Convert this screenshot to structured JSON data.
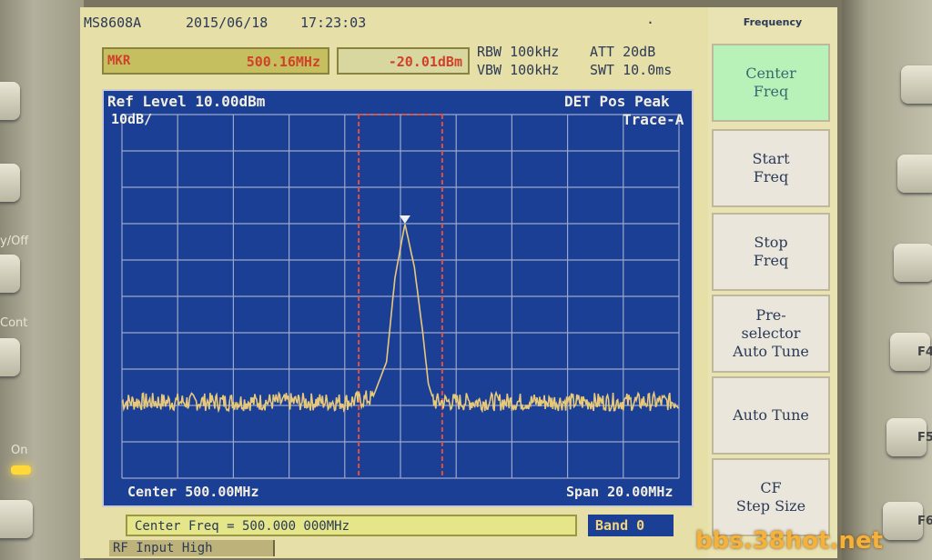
{
  "status": {
    "model": "MS8608A",
    "date": "2015/06/18",
    "time": "17:23:03",
    "indicator": "·"
  },
  "marker": {
    "label": "MKR",
    "frequency": "500.16MHz",
    "amplitude": "-20.01dBm"
  },
  "params": {
    "rbw": "RBW 100kHz",
    "vbw": "VBW 100kHz",
    "att": "ATT 20dB",
    "swt": "SWT 10.0ms"
  },
  "graph": {
    "ref_level": "Ref Level  10.00dBm",
    "scale": "10dB/",
    "detector": "DET  Pos Peak",
    "trace": "Trace-A",
    "center": "Center 500.00MHz",
    "span": "Span 20.00MHz"
  },
  "chart_data": {
    "type": "line",
    "title": "",
    "xlabel": "",
    "ylabel": "",
    "x_center_mhz": 500.0,
    "x_span_mhz": 20.0,
    "xlim": [
      490.0,
      510.0
    ],
    "ref_level_dbm": 10.0,
    "db_per_div": 10,
    "ylim": [
      -90,
      10
    ],
    "grid": true,
    "series": [
      {
        "x": [
          490.0,
          492.0,
          494.0,
          496.0,
          498.0,
          499.0,
          499.5,
          499.8,
          500.16,
          500.5,
          500.8,
          501.0,
          501.2,
          502.0,
          504.0,
          506.0,
          508.0,
          510.0
        ],
        "y": [
          -69.0,
          -69.0,
          -69.0,
          -69.0,
          -69.0,
          -68.0,
          -58.0,
          -35.0,
          -20.01,
          -32.0,
          -50.0,
          -64.0,
          -69.0,
          -69.0,
          -69.0,
          -69.0,
          -69.0,
          -69.0
        ]
      }
    ],
    "noise_floor_dbm": -69.0,
    "marker": {
      "x": 500.16,
      "y": -20.01
    },
    "window_lines_mhz": [
      498.5,
      501.5
    ],
    "colors": {
      "trace": "#e8c97a",
      "grid": "#9aa8c8",
      "window": "#e05040",
      "background": "#1c3f96"
    }
  },
  "command_line": "Center Freq = 500.000 000MHz",
  "band": "Band 0",
  "rf_status": "RF Input High",
  "menu": {
    "title": "Frequency",
    "keys": [
      {
        "label": "Center\nFreq",
        "active": true
      },
      {
        "label": "Start\nFreq",
        "active": false
      },
      {
        "label": "Stop\nFreq",
        "active": false
      },
      {
        "label": "Pre-\nselector\nAuto Tune",
        "active": false
      },
      {
        "label": "Auto Tune",
        "active": false
      },
      {
        "label": "CF\nStep Size",
        "active": false
      }
    ]
  },
  "bezel": {
    "left_labels": [
      "y/Off",
      "Cont",
      "On"
    ],
    "right_labels": [
      "F4",
      "F5",
      "F6"
    ]
  },
  "watermark": "bbs.38hot.net"
}
